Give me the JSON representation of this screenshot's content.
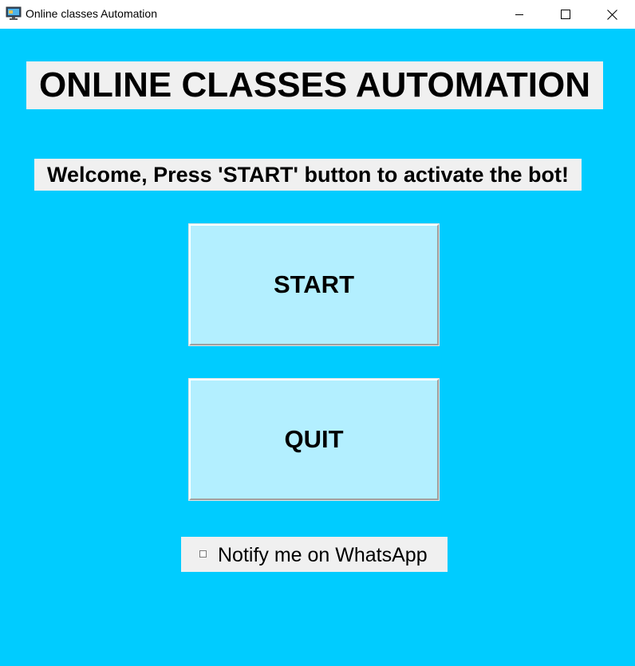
{
  "window": {
    "title": "Online classes Automation",
    "app_icon": "monitor-icon",
    "controls": {
      "minimize_icon": "minimize-icon",
      "maximize_icon": "maximize-icon",
      "close_icon": "close-icon"
    },
    "background_color": "#00ccff"
  },
  "main": {
    "heading": "ONLINE CLASSES AUTOMATION",
    "welcome_text": "Welcome, Press 'START' button to activate the bot!",
    "start_label": "START",
    "quit_label": "QUIT",
    "notify_label": "Notify me on WhatsApp",
    "notify_checked": false,
    "button_color": "#b3efff",
    "label_background": "#f0f0f0"
  }
}
